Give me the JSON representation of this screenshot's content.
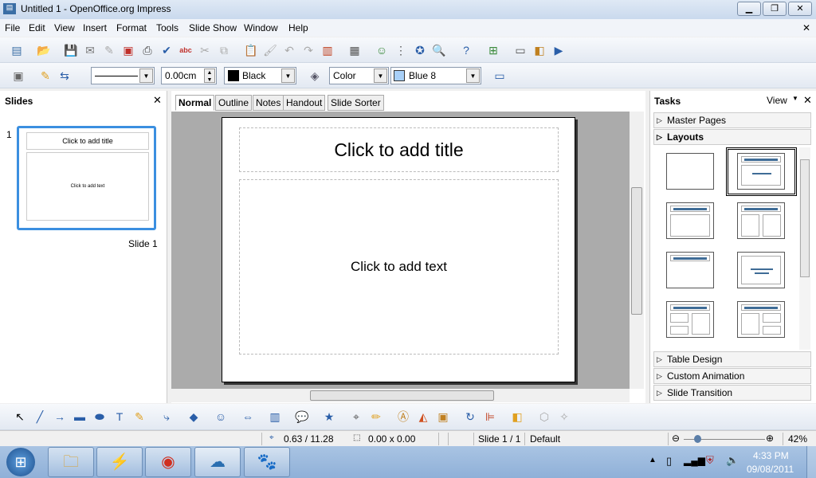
{
  "window": {
    "title": "Untitled 1 - OpenOffice.org Impress",
    "minimize": "▁",
    "maximize": "❐",
    "close": "✕"
  },
  "menu": [
    "File",
    "Edit",
    "View",
    "Insert",
    "Format",
    "Tools",
    "Slide Show",
    "Window",
    "Help"
  ],
  "menu_close": "✕",
  "toolbar1": [
    {
      "name": "new-icon",
      "g": "▤",
      "c": "#3a6ea5"
    },
    {
      "name": "open-icon",
      "g": "📂",
      "c": "#e0a020"
    },
    {
      "name": "save-icon",
      "g": "💾",
      "c": "#999"
    },
    {
      "name": "email-icon",
      "g": "✉",
      "c": "#777"
    },
    {
      "name": "edit-file-icon",
      "g": "✎",
      "c": "#aaa"
    },
    {
      "name": "export-pdf-icon",
      "g": "▣",
      "c": "#c0302a"
    },
    {
      "name": "print-icon",
      "g": "⎙",
      "c": "#444"
    },
    {
      "name": "spellcheck-icon",
      "g": "✔",
      "c": "#2a5ea8"
    },
    {
      "name": "autospellcheck-icon",
      "g": "abc",
      "c": "#c0302a"
    },
    {
      "name": "cut-icon",
      "g": "✂",
      "c": "#aaa"
    },
    {
      "name": "copy-icon",
      "g": "⧉",
      "c": "#aaa"
    },
    {
      "name": "paste-icon",
      "g": "📋",
      "c": "#b08030"
    },
    {
      "name": "clone-format-icon",
      "g": "🖌",
      "c": "#aaa"
    },
    {
      "name": "undo-icon",
      "g": "↶",
      "c": "#aaa"
    },
    {
      "name": "redo-icon",
      "g": "↷",
      "c": "#aaa"
    },
    {
      "name": "chart-icon",
      "g": "▥",
      "c": "#c04020"
    },
    {
      "name": "table-icon",
      "g": "▦",
      "c": "#555"
    },
    {
      "name": "emoticon-icon",
      "g": "☺",
      "c": "#3a8a3a"
    },
    {
      "name": "grid-icon",
      "g": "⋮",
      "c": "#555"
    },
    {
      "name": "navigator-icon",
      "g": "✪",
      "c": "#2a5ea8"
    },
    {
      "name": "zoom-icon",
      "g": "🔍",
      "c": "#555"
    },
    {
      "name": "help-icon",
      "g": "?",
      "c": "#2a5ea8"
    },
    {
      "name": "new-slide-icon",
      "g": "⊞",
      "c": "#3a8a3a"
    },
    {
      "name": "slide-layout-icon",
      "g": "▭",
      "c": "#555"
    },
    {
      "name": "slide-design-icon",
      "g": "◧",
      "c": "#c08020"
    },
    {
      "name": "slide-show-icon",
      "g": "▶",
      "c": "#2a5ea8"
    }
  ],
  "toolbar2": {
    "line_style": "",
    "line_width": "0.00cm",
    "line_color": "Black",
    "line_color_hex": "#000000",
    "area_style": "Color",
    "area_color": "Blue 8",
    "area_color_hex": "#a8d0f8"
  },
  "slides_panel": {
    "title": "Slides",
    "slide_number": "1",
    "thumb_title": "Click to add title",
    "thumb_text": "Click to add text",
    "slide_label": "Slide 1"
  },
  "view_tabs": [
    "Normal",
    "Outline",
    "Notes",
    "Handout",
    "Slide Sorter"
  ],
  "slide": {
    "title_placeholder": "Click to add title",
    "text_placeholder": "Click to add text"
  },
  "tasks": {
    "title": "Tasks",
    "view": "View",
    "sections": [
      "Master Pages",
      "Layouts",
      "Table Design",
      "Custom Animation",
      "Slide Transition"
    ]
  },
  "status": {
    "position": "0.63 / 11.28",
    "size": "0.00 x 0.00",
    "slide": "Slide 1 / 1",
    "master": "Default",
    "zoom": "42%",
    "zoom_fraction": 0.42
  },
  "taskbar": {
    "time": "4:33 PM",
    "date": "09/08/2011"
  }
}
